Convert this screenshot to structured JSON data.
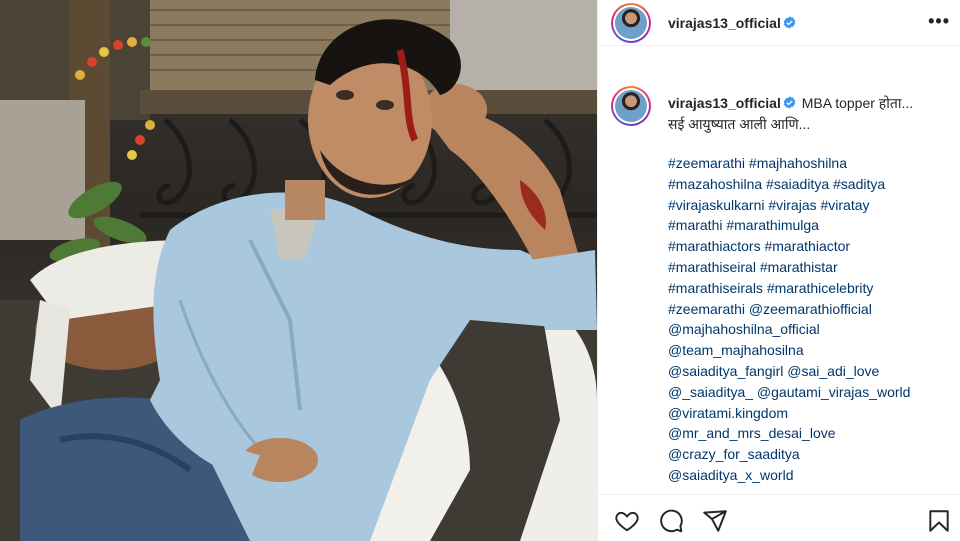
{
  "post": {
    "username": "virajas13_official",
    "more_icon": "more-options-icon",
    "verified_icon": "verified-badge-icon",
    "caption_line1": "MBA topper होता...",
    "caption_line2": "सई आयुष्यात आली आणि...",
    "hashtag_lines": [
      "#zeemarathi #majhahoshilna",
      "#mazahoshilna #saiaditya #saditya",
      "#virajaskulkarni #virajas #viratay",
      "#marathi #marathimulga",
      "#marathiactors #marathiactor",
      "#marathiseiral #marathistar",
      "#marathiseirals #marathicelebrity",
      "#zeemarathi @zeemarathiofficial",
      "@majhahoshilna_official",
      "@team_majhahosilna",
      "@saiaditya_fangirl @sai_adi_love",
      "@_saiaditya_ @gautami_virajas_world",
      "@viratami.kingdom",
      "@mr_and_mrs_desai_love",
      "@crazy_for_saaditya",
      "@saiaditya_x_world"
    ]
  },
  "actions": [
    "like-heart-icon",
    "comment-icon",
    "share-icon",
    "save-bookmark-icon"
  ],
  "colors": {
    "link": "#00376b",
    "text": "#262626",
    "verified": "#3897f0",
    "border": "#efefef"
  }
}
